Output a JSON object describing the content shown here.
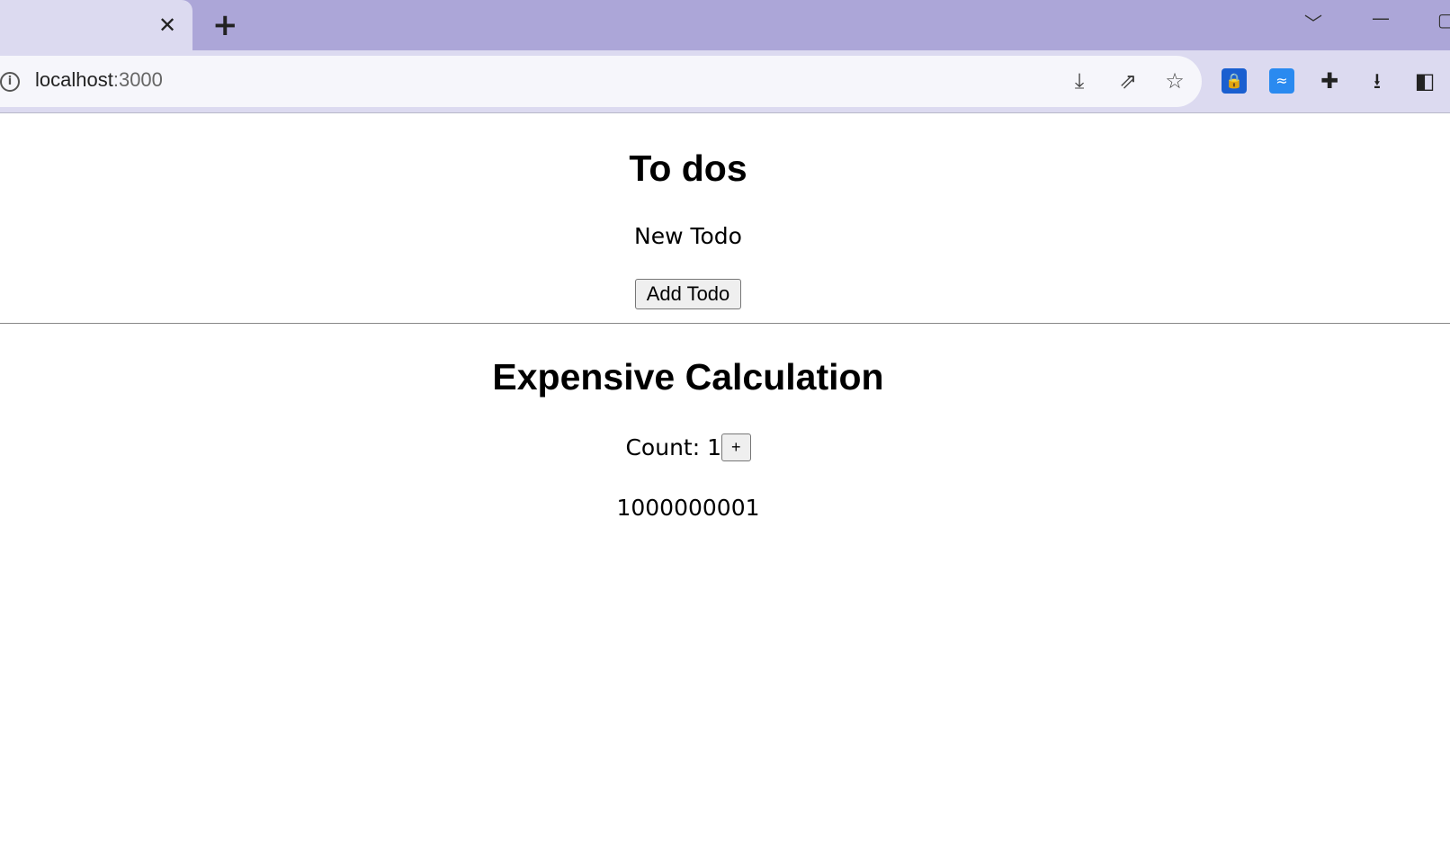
{
  "browser": {
    "tab_close": "✕",
    "new_tab": "+",
    "url_host": "localhost",
    "url_port": ":3000",
    "accent": "#aca6d8"
  },
  "page": {
    "todos_title": "To dos",
    "new_todo_label": "New Todo",
    "add_todo_button": "Add Todo",
    "calc_title": "Expensive Calculation",
    "count_label": "Count: 1",
    "increment_button": "+",
    "result": "1000000001"
  }
}
